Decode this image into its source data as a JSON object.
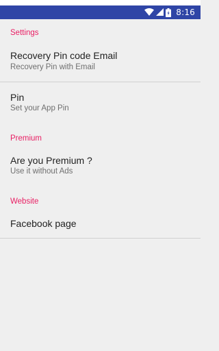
{
  "status_bar": {
    "time": "8:16",
    "icons": [
      "wifi-icon",
      "cell-signal-icon",
      "battery-icon"
    ]
  },
  "settings": {
    "category_settings": "Settings",
    "recovery_title": "Recovery Pin code Email",
    "recovery_summary": "Recovery Pin with Email",
    "pin_title": "Pin",
    "pin_summary": "Set your App Pin",
    "category_premium": "Premium",
    "premium_title": "Are you Premium ?",
    "premium_summary": "Use it without Ads",
    "category_website": "Website",
    "facebook_title": "Facebook page"
  },
  "colors": {
    "status_bar": "#2f45a6",
    "accent": "#e91e63",
    "background": "#efefef"
  }
}
